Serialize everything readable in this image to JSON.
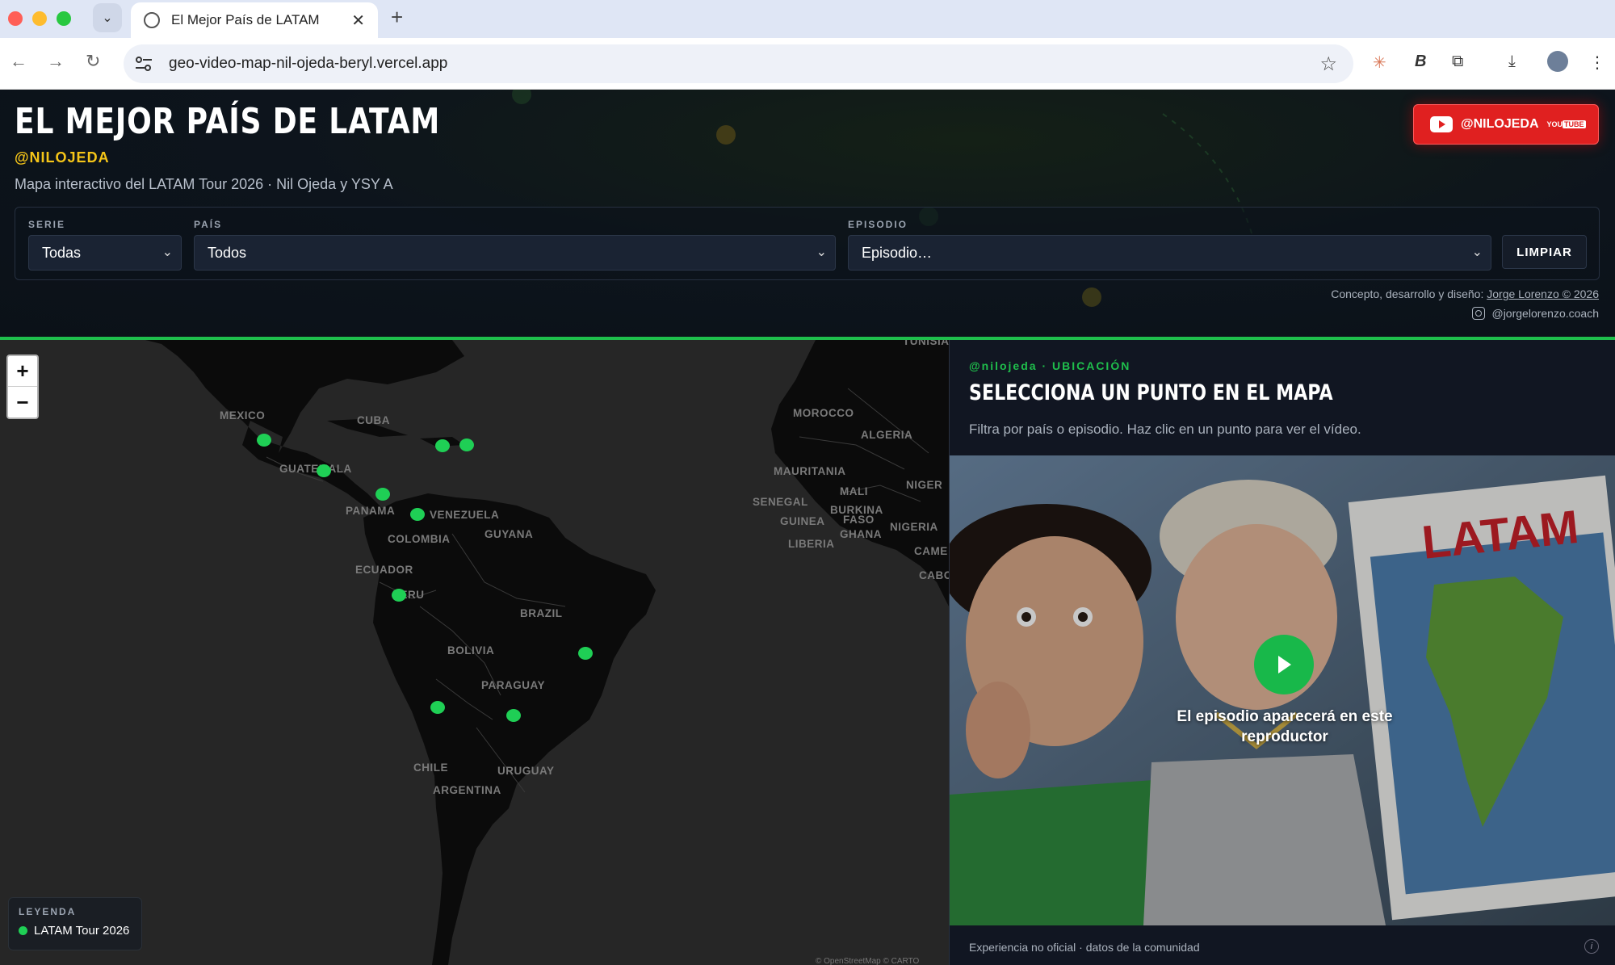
{
  "browser": {
    "tab_title": "El Mejor País de LATAM",
    "url": "geo-video-map-nil-ojeda-beryl.vercel.app"
  },
  "header": {
    "title": "EL MEJOR PAÍS DE LATAM",
    "handle": "@NILOJEDA",
    "subtitle": "Mapa interactivo del LATAM Tour 2026 · Nil Ojeda y YSY A",
    "youtube_label": "@NILOJEDA",
    "youtube_tag_you": "YOU",
    "youtube_tag_tube": "TUBE"
  },
  "filters": {
    "serie_label": "SERIE",
    "serie_value": "Todas",
    "pais_label": "PAÍS",
    "pais_value": "Todos",
    "episodio_label": "EPISODIO",
    "episodio_value": "Episodio…",
    "clear_label": "LIMPIAR"
  },
  "credits": {
    "line1_prefix": "Concepto, desarrollo y diseño: ",
    "author": "Jorge Lorenzo © 2026",
    "instagram": "@jorgelorenzo.coach"
  },
  "map": {
    "zoom_in": "+",
    "zoom_out": "−",
    "legend_title": "LEYENDA",
    "legend_item": "LATAM Tour 2026",
    "attribution": "© OpenStreetMap © CARTO",
    "marker_color": "#1fcf55",
    "labels": {
      "mexico": "MEXICO",
      "cuba": "CUBA",
      "guatemala": "GUATEMALA",
      "panama": "PANAMA",
      "venezuela": "VENEZUELA",
      "guyana": "GUYANA",
      "colombia": "COLOMBIA",
      "ecuador": "ECUADOR",
      "peru": "PERU",
      "brazil": "BRAZIL",
      "bolivia": "BOLIVIA",
      "paraguay": "PARAGUAY",
      "chile": "CHILE",
      "uruguay": "URUGUAY",
      "argentina": "ARGENTINA",
      "morocco": "MOROCCO",
      "algeria": "ALGERIA",
      "mauritania": "MAURITANIA",
      "mali": "MALI",
      "niger": "NIGER",
      "senegal": "SENEGAL",
      "burkina": "BURKINA",
      "faso": "FASO",
      "guinea": "GUINEA",
      "ghana": "GHANA",
      "nigeria": "NIGERIA",
      "liberia": "LIBERIA",
      "came": "CAME",
      "cabo": "CABO",
      "tunisia": "TUNISIA"
    }
  },
  "panel": {
    "kicker": "@nilojeda · UBICACIÓN",
    "title": "SELECCIONA UN PUNTO EN EL MAPA",
    "description": "Filtra por país o episodio. Haz clic en un punto para ver el vídeo.",
    "video_caption": "El episodio aparecerá en este reproductor",
    "thumbnail_text": "LATAM",
    "footer": "Experiencia no oficial · datos de la comunidad",
    "info": "i"
  },
  "colors": {
    "accent_green": "#1fbf4c",
    "youtube_red": "#e02020",
    "handle_yellow": "#f5c518"
  }
}
